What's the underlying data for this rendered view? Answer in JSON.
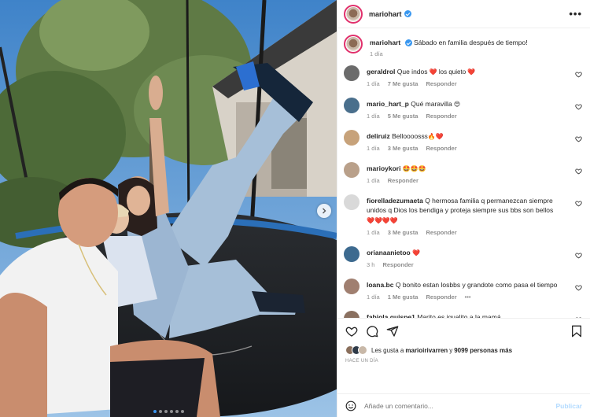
{
  "post": {
    "username": "mariohart",
    "caption": "Sábado en familia después de tiempo!",
    "caption_time": "1 día",
    "more_label": "•••"
  },
  "comments": [
    {
      "user": "geraldrol",
      "text": "Que indos",
      "emoji": " ❤️  los quieto ❤️",
      "time": "1 día",
      "likes": "7 Me gusta",
      "reply": "Responder",
      "color": "#6b6b6b"
    },
    {
      "user": "mario_hart_p",
      "text": "Qué maravilla",
      "emoji": " 😍",
      "time": "1 día",
      "likes": "5 Me gusta",
      "reply": "Responder",
      "color": "#4a6f8c"
    },
    {
      "user": "deliruiz",
      "text": "Bellooooss",
      "emoji": "s🔥❤️",
      "time": "1 día",
      "likes": "3 Me gusta",
      "reply": "Responder",
      "color": "#c7a27a"
    },
    {
      "user": "marioykori",
      "text": "",
      "emoji": "🤩🤩🤩",
      "time": "1 día",
      "likes": "",
      "reply": "Responder",
      "color": "#b9a08a"
    },
    {
      "user": "fiorelladezumaeta",
      "text": "Q hermosa familia q permanezcan siempre unidos q Dios los bendiga y proteja siempre sus bbs son bellos",
      "emoji": " ❤️❤️❤️❤️",
      "time": "1 día",
      "likes": "3 Me gusta",
      "reply": "Responder",
      "color": "#d9d9d9"
    },
    {
      "user": "orianaanietoo",
      "text": "",
      "emoji": "❤️",
      "time": "3 h",
      "likes": "",
      "reply": "Responder",
      "color": "#3d6a8f"
    },
    {
      "user": "loana.bc",
      "text": "Q bonito estan losbbs y grandote como pasa el tiempo",
      "emoji": "",
      "time": "1 día",
      "likes": "1 Me gusta",
      "reply": "Responder",
      "more": "•••",
      "color": "#a07f70"
    },
    {
      "user": "fabiola.quispe1",
      "text": "Marito es igualito a la mamá",
      "emoji": "",
      "time": "",
      "likes": "",
      "reply": "",
      "color": "#8a7060"
    }
  ],
  "likes": {
    "prefix": "Les gusta a ",
    "user": "marioirivarren",
    "middle": " y ",
    "others": "9099 personas más"
  },
  "posted": "HACE UN DÍA",
  "add_comment": {
    "placeholder": "Añade un comentario...",
    "publish": "Publicar"
  },
  "colors": {
    "accent": "#0095f6",
    "verified": "#3897f0",
    "heart": "#ed4956"
  },
  "carousel": {
    "count": 6,
    "active_index": 0
  }
}
